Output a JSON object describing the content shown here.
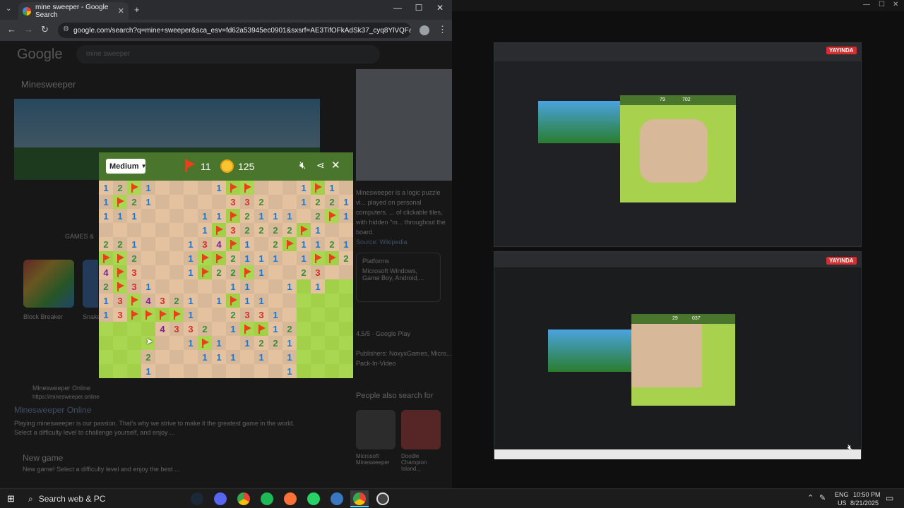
{
  "browser": {
    "tab_title": "mine sweeper - Google Search",
    "url": "google.com/search?q=mine+sweeper&sca_esv=fd62a53945ec0901&sxsrf=AE3TifOFkAdSk37_cyq8YlVQFaz..."
  },
  "google": {
    "logo": "Google",
    "search_value": "mine sweeper",
    "panel_title": "Minesweeper",
    "games_label": "GAMES &",
    "game1": "Block Breaker",
    "game2": "Snake",
    "desc": "Minesweeper is a logic puzzle vi... played on personal computers. ... of clickable tiles, with hidden \"m... throughout the board.",
    "source": "Source: Wikipedia",
    "platforms_label": "Platforms",
    "platforms_value": "Microsoft Windows, Game Boy, Android,...",
    "rating": "4.5/5 · Google Play",
    "publishers": "Publishers: NoxyxGames, Micro...",
    "publishers2": "Pack-In-Video",
    "result_site": "Minesweeper Online",
    "result_url": "https://minesweeper.online",
    "result_title": "Minesweeper Online",
    "result_snippet": "Playing minesweeper is our passion. That's why we strive to make it the greatest game in the world. Select a difficulty level to challenge yourself, and enjoy ...",
    "new_game": "New game",
    "new_game_snippet": "New game! Select a difficulty level and enjoy the best ...",
    "people_also": "People also search for",
    "pa1": "Microsoft Minesweeper",
    "pa2": "Doodle Champion Island..."
  },
  "minesweeper": {
    "difficulty": "Medium",
    "flags": "11",
    "time": "125",
    "rows": [
      "12F1....1FF...1F1.",
      "1F21.....332..1221",
      "111....11F2111.2F1",
      ".......1F32222F1..",
      "221...134F1.2F1121",
      "FF2...1FF2111.1FF2",
      "4F3...1F22F1..23..",
      "2F31.....11..1.1..",
      "13F4321.1F11......",
      "13FFFF1..2331.....",
      "GGGG4332.1FF12....",
      "GGGG..1F1.1221....",
      "GGG2...111.1.1....",
      "GGG1.........1...."
    ],
    "grass_cols": [
      0,
      0,
      0,
      0,
      0,
      0,
      0,
      0,
      0,
      0,
      0,
      0,
      0,
      0
    ]
  },
  "right": {
    "live_badge_1": "YAYINDA",
    "live_badge_2": "YAYINDA",
    "mini1_flags": "79",
    "mini1_time": "702",
    "mini2_flags": "29",
    "mini2_time": "037"
  },
  "taskbar": {
    "search_placeholder": "Search web & PC",
    "lang1": "ENG",
    "lang2": "US",
    "time": "10:50 PM",
    "date": "8/21/2025"
  },
  "colors": {
    "header_green": "#4a752c",
    "flag_red": "#e6411b",
    "grass_light": "#aad751",
    "grass_dark": "#a2d149",
    "open_light": "#e5c29f",
    "open_dark": "#d7b899"
  }
}
